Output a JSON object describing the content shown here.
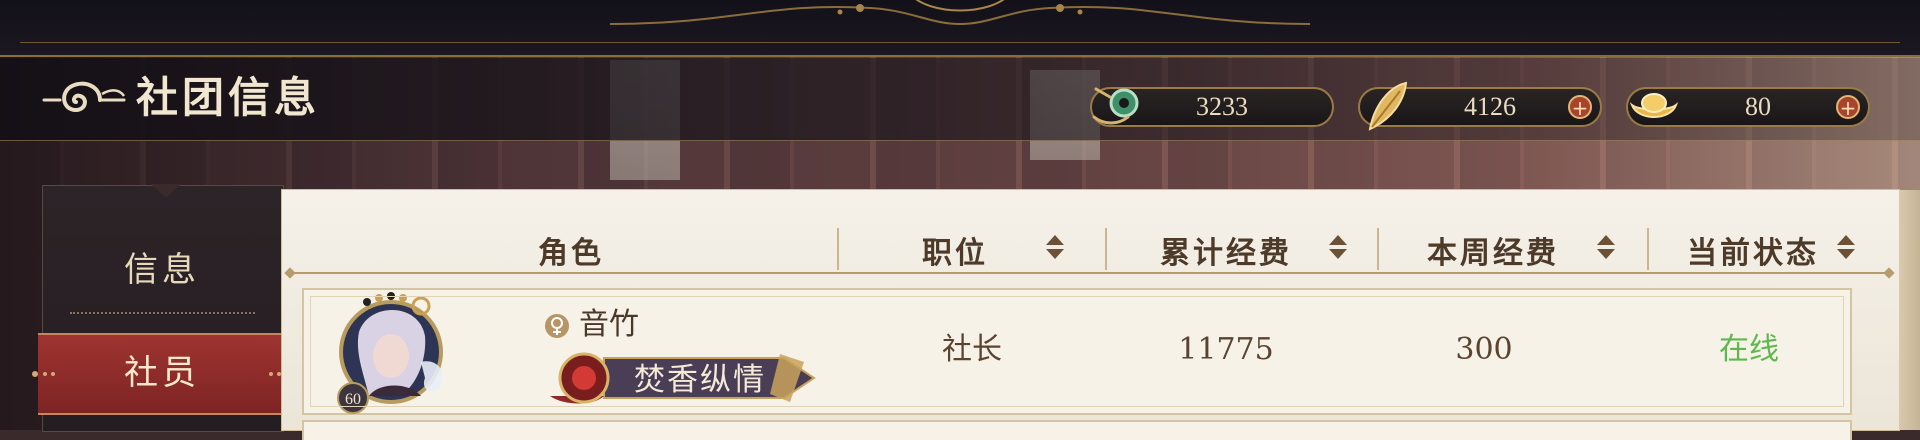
{
  "header": {
    "title": "社团信息"
  },
  "currencies": [
    {
      "icon": "jade-coin-icon",
      "value": "3233",
      "has_plus": false
    },
    {
      "icon": "golden-feather-icon",
      "value": "4126",
      "has_plus": true
    },
    {
      "icon": "gold-ingot-icon",
      "value": "80",
      "has_plus": true
    }
  ],
  "sidebar": {
    "tabs": [
      {
        "label": "信息",
        "active": false
      },
      {
        "label": "社员",
        "active": true
      }
    ]
  },
  "table": {
    "columns": [
      "角色",
      "职位",
      "累计经费",
      "本周经费",
      "当前状态"
    ],
    "rows": [
      {
        "level": "60",
        "gender": "female",
        "name": "音竹",
        "badge": "焚香纵情",
        "position": "社长",
        "total_funds": "11775",
        "weekly_funds": "300",
        "status": "在线"
      }
    ]
  },
  "colors": {
    "accent_gold": "#9a7b46",
    "active_tab_red": "#9e3430",
    "online_green": "#5fb84e",
    "panel_bg": "#f5f1e9"
  }
}
